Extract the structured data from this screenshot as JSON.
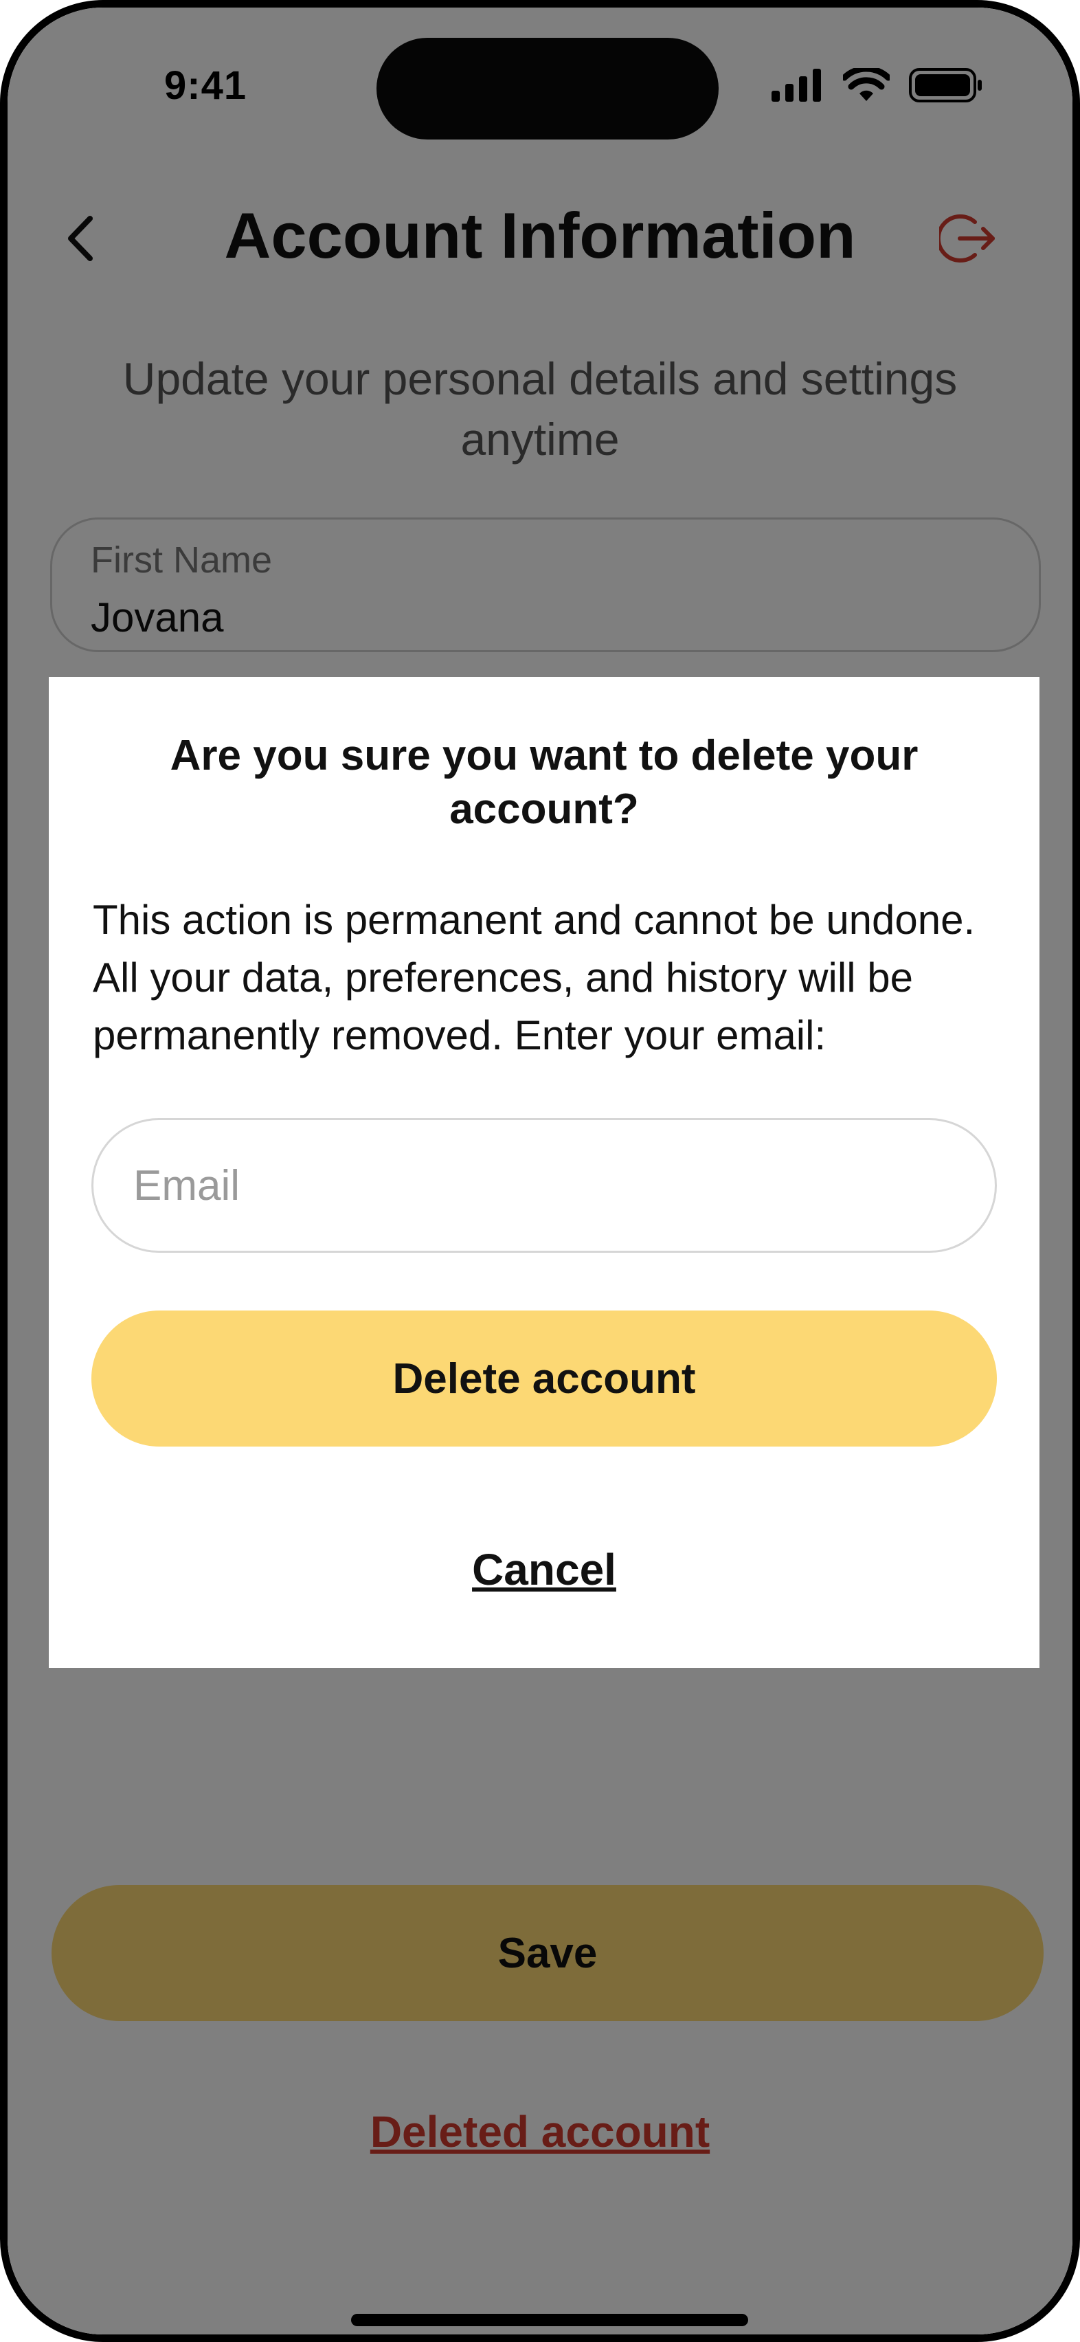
{
  "status_bar": {
    "time": "9:41",
    "icons": [
      "signal-icon",
      "wifi-icon",
      "battery-icon"
    ]
  },
  "header": {
    "title": "Account Information",
    "back_icon": "chevron-left-icon",
    "logout_icon": "logout-icon",
    "logout_color": "#d03a2f"
  },
  "subtitle": "Update your personal details and settings anytime",
  "form": {
    "first_name": {
      "label": "First Name",
      "value": "Jovana"
    }
  },
  "save_label": "Save",
  "deleted_account_label": "Deleted account",
  "modal": {
    "title": "Are you sure you want to delete your account?",
    "body": "This action is permanent and cannot be undone. All your data, preferences, and history will be permanently removed. Enter your email:",
    "email": {
      "value": "",
      "placeholder": "Email"
    },
    "delete_label": "Delete account",
    "cancel_label": "Cancel"
  },
  "colors": {
    "accent": "#fcd874",
    "danger": "#d03a2f",
    "overlay": "rgba(0,0,0,0.5)"
  }
}
